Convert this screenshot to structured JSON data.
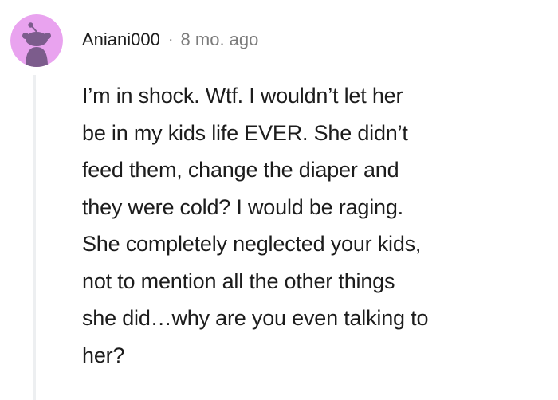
{
  "comment": {
    "author": "Aniani000",
    "separator": "·",
    "timestamp": "8 mo. ago",
    "body_lines": [
      "I’m in shock. Wtf. I wouldn’t let her",
      "be in my kids life EVER. She didn’t",
      "feed them, change the diaper and",
      "they were cold? I would be raging.",
      "She completely neglected your kids,",
      "not to mention all the other things",
      "she did…why are you even talking to",
      "her?"
    ],
    "avatar": {
      "icon": "snoo-avatar-icon",
      "background_color": "#e9a3ef",
      "figure_color": "#7c5c8c"
    }
  }
}
